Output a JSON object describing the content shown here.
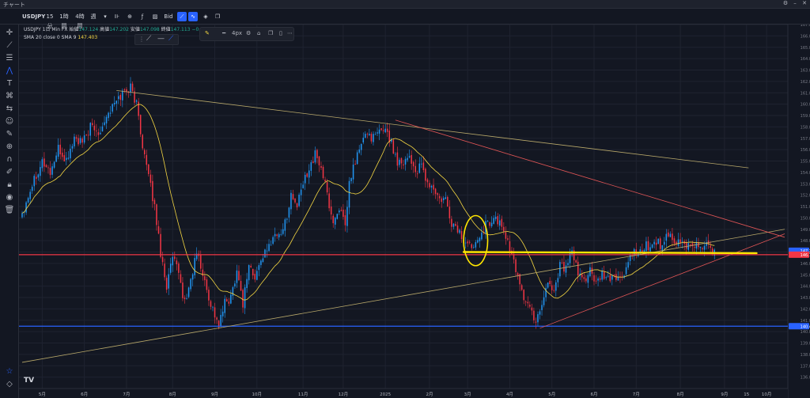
{
  "window": {
    "title": "チャート"
  },
  "toolbar": {
    "symbol": "USDJPY",
    "intervals": [
      "15分",
      "1時間",
      "4時間",
      "週"
    ],
    "price_source": "Bid"
  },
  "legend": {
    "symbol_line": "USDJPY 1日 Min FX",
    "open_label": "始値",
    "open": "147.124",
    "high_label": "高値",
    "high": "147.202",
    "low_label": "安値",
    "low": "147.098",
    "close_label": "終値",
    "close": "147.113",
    "change": "−0.095 (−0.04%)",
    "sma_label": "SMA 20 close 0 SMA 9",
    "sma_value": "147.403"
  },
  "style_toolbar": {
    "width_label": "4px"
  },
  "colors": {
    "background": "#131722",
    "up": "#22ab94",
    "down": "#f23645",
    "sma": "#f5d742",
    "horizontal_red": "#f23645",
    "horizontal_blue": "#2962ff",
    "trend_yellow": "#b8a86a",
    "trend_red": "#e05555",
    "highlight": "#ffe600"
  },
  "icons": [
    "crosshair-icon",
    "trendline-icon",
    "fib-icon",
    "pattern-icon",
    "text-icon",
    "measure-icon",
    "zoom-icon",
    "magnet-icon",
    "lock-icon",
    "eye-icon",
    "trash-icon"
  ],
  "chart_data": {
    "type": "candlestick",
    "ylim": [
      135,
      167
    ],
    "yticks": [
      136,
      137,
      138,
      139,
      140,
      141,
      142,
      143,
      144,
      145,
      146,
      147,
      148,
      149,
      150,
      151,
      152,
      153,
      154,
      155,
      156,
      157,
      158,
      159,
      160,
      161,
      162,
      163,
      164,
      165,
      166,
      167
    ],
    "xticks": [
      {
        "label": "5月",
        "i": 10
      },
      {
        "label": "6月",
        "i": 31
      },
      {
        "label": "7月",
        "i": 52
      },
      {
        "label": "8月",
        "i": 75
      },
      {
        "label": "9月",
        "i": 96
      },
      {
        "label": "10月",
        "i": 117
      },
      {
        "label": "11月",
        "i": 140
      },
      {
        "label": "12月",
        "i": 160
      },
      {
        "label": "2025",
        "i": 181
      },
      {
        "label": "2月",
        "i": 203
      },
      {
        "label": "3月",
        "i": 222
      },
      {
        "label": "4月",
        "i": 243
      },
      {
        "label": "5月",
        "i": 264
      },
      {
        "label": "6月",
        "i": 285
      },
      {
        "label": "7月",
        "i": 306
      },
      {
        "label": "8月",
        "i": 328
      },
      {
        "label": "9月",
        "i": 350
      },
      {
        "label": "15",
        "i": 361
      },
      {
        "label": "10月",
        "i": 371
      }
    ],
    "price_labels": [
      {
        "value": 147.113,
        "text": "147.113",
        "color": "#2962ff"
      },
      {
        "value": 146.764,
        "text": "146.764",
        "color": "#f23645"
      },
      {
        "value": 140.477,
        "text": "140.477",
        "color": "#2962ff"
      }
    ],
    "horizontal_lines": [
      {
        "value": 146.764,
        "color": "#f23645"
      },
      {
        "value": 140.477,
        "color": "#2962ff"
      }
    ],
    "anchors": [
      [
        0,
        150.5
      ],
      [
        6,
        153.5
      ],
      [
        10,
        155.0
      ],
      [
        14,
        154.0
      ],
      [
        18,
        156.0
      ],
      [
        22,
        155.0
      ],
      [
        26,
        157.0
      ],
      [
        30,
        156.5
      ],
      [
        34,
        158.0
      ],
      [
        38,
        157.5
      ],
      [
        42,
        159.0
      ],
      [
        46,
        160.0
      ],
      [
        50,
        161.0
      ],
      [
        54,
        161.5
      ],
      [
        57,
        160.0
      ],
      [
        60,
        156.5
      ],
      [
        63,
        153.5
      ],
      [
        66,
        151.0
      ],
      [
        69,
        147.0
      ],
      [
        72,
        144.0
      ],
      [
        75,
        146.5
      ],
      [
        78,
        145.0
      ],
      [
        81,
        142.5
      ],
      [
        84,
        144.5
      ],
      [
        87,
        147.0
      ],
      [
        90,
        145.0
      ],
      [
        93,
        143.0
      ],
      [
        96,
        141.5
      ],
      [
        98,
        140.5
      ],
      [
        101,
        142.5
      ],
      [
        104,
        143.0
      ],
      [
        107,
        145.5
      ],
      [
        110,
        142.5
      ],
      [
        113,
        146.0
      ],
      [
        116,
        144.5
      ],
      [
        119,
        146.5
      ],
      [
        122,
        147.0
      ],
      [
        125,
        148.5
      ],
      [
        128,
        148.5
      ],
      [
        131,
        149.5
      ],
      [
        134,
        152.0
      ],
      [
        137,
        151.0
      ],
      [
        140,
        153.0
      ],
      [
        143,
        154.5
      ],
      [
        146,
        155.5
      ],
      [
        149,
        154.5
      ],
      [
        152,
        152.0
      ],
      [
        155,
        149.5
      ],
      [
        158,
        151.0
      ],
      [
        161,
        149.0
      ],
      [
        163,
        153.0
      ],
      [
        166,
        155.0
      ],
      [
        169,
        156.5
      ],
      [
        172,
        157.5
      ],
      [
        175,
        157.0
      ],
      [
        178,
        157.5
      ],
      [
        181,
        158.0
      ],
      [
        184,
        156.5
      ],
      [
        187,
        155.0
      ],
      [
        190,
        155.0
      ],
      [
        193,
        155.5
      ],
      [
        196,
        154.0
      ],
      [
        199,
        154.5
      ],
      [
        202,
        153.0
      ],
      [
        205,
        152.5
      ],
      [
        208,
        151.5
      ],
      [
        211,
        151.5
      ],
      [
        214,
        149.5
      ],
      [
        217,
        149.0
      ],
      [
        220,
        148.0
      ],
      [
        223,
        147.5
      ],
      [
        226,
        148.0
      ],
      [
        229,
        149.0
      ],
      [
        232,
        149.5
      ],
      [
        235,
        150.0
      ],
      [
        238,
        149.5
      ],
      [
        241,
        148.5
      ],
      [
        244,
        146.5
      ],
      [
        247,
        145.0
      ],
      [
        250,
        143.0
      ],
      [
        253,
        142.0
      ],
      [
        256,
        141.0
      ],
      [
        259,
        142.5
      ],
      [
        262,
        144.5
      ],
      [
        265,
        143.5
      ],
      [
        268,
        146.0
      ],
      [
        271,
        145.5
      ],
      [
        274,
        147.0
      ],
      [
        277,
        145.0
      ],
      [
        280,
        144.5
      ],
      [
        283,
        145.5
      ],
      [
        286,
        144.0
      ],
      [
        289,
        145.0
      ],
      [
        292,
        144.5
      ],
      [
        295,
        145.0
      ],
      [
        298,
        144.5
      ],
      [
        301,
        145.5
      ],
      [
        304,
        147.0
      ],
      [
        307,
        146.5
      ],
      [
        310,
        147.5
      ],
      [
        313,
        147.5
      ],
      [
        316,
        148.0
      ],
      [
        319,
        147.5
      ],
      [
        322,
        148.5
      ],
      [
        325,
        147.5
      ],
      [
        328,
        148.0
      ],
      [
        331,
        147.5
      ],
      [
        334,
        147.8
      ],
      [
        337,
        147.5
      ],
      [
        340,
        147.6
      ],
      [
        343,
        147.3
      ],
      [
        345,
        147.2
      ]
    ],
    "trendlines": [
      {
        "from": [
          47,
          161.2
        ],
        "to": [
          362,
          154.4
        ],
        "color": "#b8a86a"
      },
      {
        "from": [
          0,
          137.3
        ],
        "to": [
          380,
          149.0
        ],
        "color": "#b8a86a"
      },
      {
        "from": [
          186,
          158.6
        ],
        "to": [
          380,
          148.3
        ],
        "color": "#e05555"
      },
      {
        "from": [
          258,
          140.3
        ],
        "to": [
          380,
          148.6
        ],
        "color": "#e05555"
      }
    ],
    "highlight_line": {
      "from": [
        220,
        147.0
      ],
      "to": [
        366,
        146.9
      ],
      "color": "#ffe600"
    },
    "highlight_circle": {
      "cx": 226,
      "cy": 148.0,
      "rx": 6,
      "ry": 2.2,
      "color": "#ffe600"
    }
  }
}
